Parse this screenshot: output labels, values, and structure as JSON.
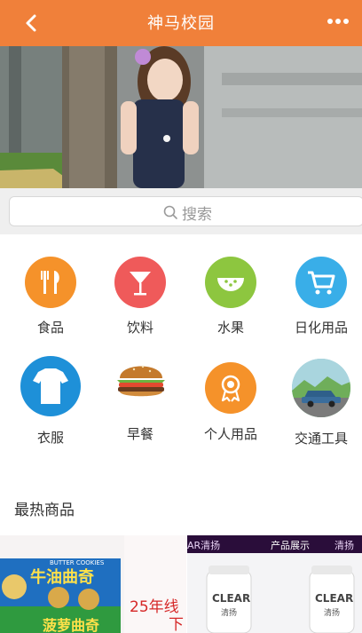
{
  "header": {
    "title": "神马校园",
    "back_icon": "chevron-left-icon",
    "more_icon": "ellipsis-icon",
    "color": "#f0803a"
  },
  "banner": {
    "slide_count": 9,
    "active_index": 0
  },
  "search": {
    "placeholder": "搜索",
    "icon": "search-icon"
  },
  "categories": [
    {
      "label": "食品",
      "icon": "fork-knife-icon",
      "color": "#f5922a"
    },
    {
      "label": "饮料",
      "icon": "cocktail-glass-icon",
      "color": "#ef5a5a"
    },
    {
      "label": "水果",
      "icon": "watermelon-icon",
      "color": "#8dc63f"
    },
    {
      "label": "日化用品",
      "icon": "shopping-cart-icon",
      "color": "#39aee8"
    },
    {
      "label": "衣服",
      "icon": "tshirt-icon",
      "color": "#1e90d8"
    },
    {
      "label": "早餐",
      "icon": "burger-icon",
      "color": "#c47a2c"
    },
    {
      "label": "个人用品",
      "icon": "medal-icon",
      "color": "#f5922a"
    },
    {
      "label": "交通工具",
      "icon": "car-icon",
      "color": "#8fc3cf"
    }
  ],
  "hot_section": {
    "title": "最热商品"
  },
  "products": [
    {
      "name": "butter-cookies",
      "brand_text": "BUTTER COOKIES",
      "text_1": "牛油曲奇",
      "text_2": "菠萝曲奇",
      "badge": "25年线",
      "badge_2": "下"
    },
    {
      "name": "clear-shampoo",
      "header_text": "产品展示",
      "brand_left": "AR清扬",
      "brand_right": "清扬",
      "bottle_text": "CLEAR",
      "bottle_sub": "清扬"
    }
  ]
}
